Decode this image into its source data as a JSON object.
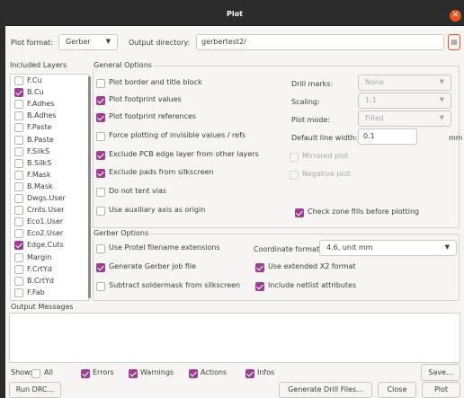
{
  "window": {
    "title": "Plot"
  },
  "top": {
    "plot_format_label": "Plot format:",
    "plot_format_value": "Gerber",
    "output_dir_label": "Output directory:",
    "output_dir_value": "gerbertest2/"
  },
  "layers": {
    "title": "Included Layers",
    "items": [
      {
        "label": "F.Cu",
        "checked": false
      },
      {
        "label": "B.Cu",
        "checked": true
      },
      {
        "label": "F.Adhes",
        "checked": false
      },
      {
        "label": "B.Adhes",
        "checked": false
      },
      {
        "label": "F.Paste",
        "checked": false
      },
      {
        "label": "B.Paste",
        "checked": false
      },
      {
        "label": "F.SilkS",
        "checked": false
      },
      {
        "label": "B.SilkS",
        "checked": false
      },
      {
        "label": "F.Mask",
        "checked": false
      },
      {
        "label": "B.Mask",
        "checked": false
      },
      {
        "label": "Dwgs.User",
        "checked": false
      },
      {
        "label": "Cmts.User",
        "checked": false
      },
      {
        "label": "Eco1.User",
        "checked": false
      },
      {
        "label": "Eco2.User",
        "checked": false
      },
      {
        "label": "Edge.Cuts",
        "checked": true
      },
      {
        "label": "Margin",
        "checked": false
      },
      {
        "label": "F.CrtYd",
        "checked": false
      },
      {
        "label": "B.CrtYd",
        "checked": false
      },
      {
        "label": "F.Fab",
        "checked": false
      }
    ]
  },
  "general": {
    "title": "General Options",
    "plot_border": "Plot border and title block",
    "plot_fp_values": "Plot footprint values",
    "plot_fp_refs": "Plot footprint references",
    "force_invisible": "Force plotting of invisible values / refs",
    "exclude_edge": "Exclude PCB edge layer from other layers",
    "exclude_pads": "Exclude pads from silkscreen",
    "no_tent": "Do not tent vias",
    "aux_origin": "Use auxiliary axis as origin",
    "drill_marks_label": "Drill marks:",
    "drill_marks_value": "None",
    "scaling_label": "Scaling:",
    "scaling_value": "1:1",
    "plot_mode_label": "Plot mode:",
    "plot_mode_value": "Filled",
    "line_width_label": "Default line width:",
    "line_width_value": "0.1",
    "line_width_unit": "mm",
    "mirrored": "Mirrored plot",
    "negative": "Negative plot",
    "check_zone": "Check zone fills before plotting"
  },
  "gerber": {
    "title": "Gerber Options",
    "protel": "Use Protel filename extensions",
    "job_file": "Generate Gerber job file",
    "subtract_mask": "Subtract soldermask from silkscreen",
    "coord_label": "Coordinate format:",
    "coord_value": "4.6, unit mm",
    "x2": "Use extended X2 format",
    "netlist": "Include netlist attributes"
  },
  "messages": {
    "title": "Output Messages",
    "show_label": "Show:",
    "all": "All",
    "errors": "Errors",
    "warnings": "Warnings",
    "actions": "Actions",
    "infos": "Infos",
    "save": "Save..."
  },
  "footer": {
    "run_drc": "Run DRC...",
    "gen_drill": "Generate Drill Files...",
    "close": "Close",
    "plot": "Plot"
  },
  "colors": {
    "accent": "#9d3e92",
    "close_button": "#e95420",
    "titlebar": "#2c2c2c"
  },
  "icons": {
    "folder": "folder-icon",
    "close": "close-icon"
  }
}
